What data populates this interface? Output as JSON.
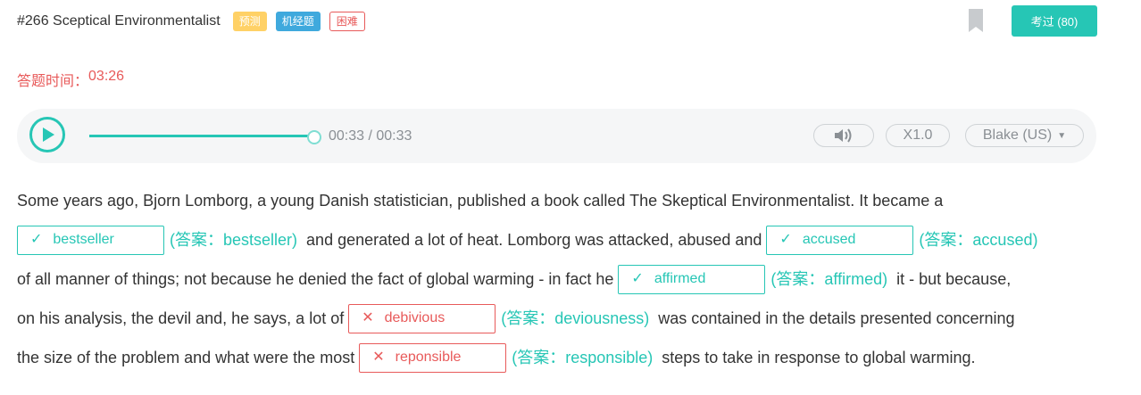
{
  "question": {
    "title": "#266 Sceptical Environmentalist",
    "tags": [
      "预测",
      "机经题",
      "困难"
    ],
    "passed_label": "考过 (80)"
  },
  "timer": {
    "label": "答题时间：",
    "value": "03:26"
  },
  "player": {
    "time": "00:33 / 00:33",
    "progress": 1.0,
    "speed": "X1.0",
    "voice": "Blake (US)"
  },
  "passage": {
    "answer_prefix": "(答案：",
    "answer_suffix": ")",
    "segments": [
      "Some years ago, Bjorn Lomborg, a young Danish statistician, published a book called The Skeptical Environmentalist. It became a",
      " and generated a lot of heat. Lomborg was attacked, abused and ",
      "of all manner of things; not because he denied the fact of global warming - in fact he ",
      " it - but because,",
      "on his analysis, the devil and, he says, a lot of ",
      " was contained in the details presented concerning",
      "the size of the problem and what were the most ",
      " steps to take in response to global warming."
    ],
    "blanks": [
      {
        "input": "bestseller",
        "answer": "bestseller",
        "status": "correct"
      },
      {
        "input": "accused",
        "answer": "accused",
        "status": "correct"
      },
      {
        "input": "affirmed",
        "answer": "affirmed",
        "status": "correct"
      },
      {
        "input": "debivious",
        "answer": "deviousness",
        "status": "wrong"
      },
      {
        "input": "reponsible",
        "answer": "responsible",
        "status": "wrong"
      }
    ]
  },
  "colors": {
    "accent": "#26c6b5",
    "error": "#e85a5a",
    "tag_predict": "#ffd166",
    "tag_jijing": "#3fa9dd"
  }
}
